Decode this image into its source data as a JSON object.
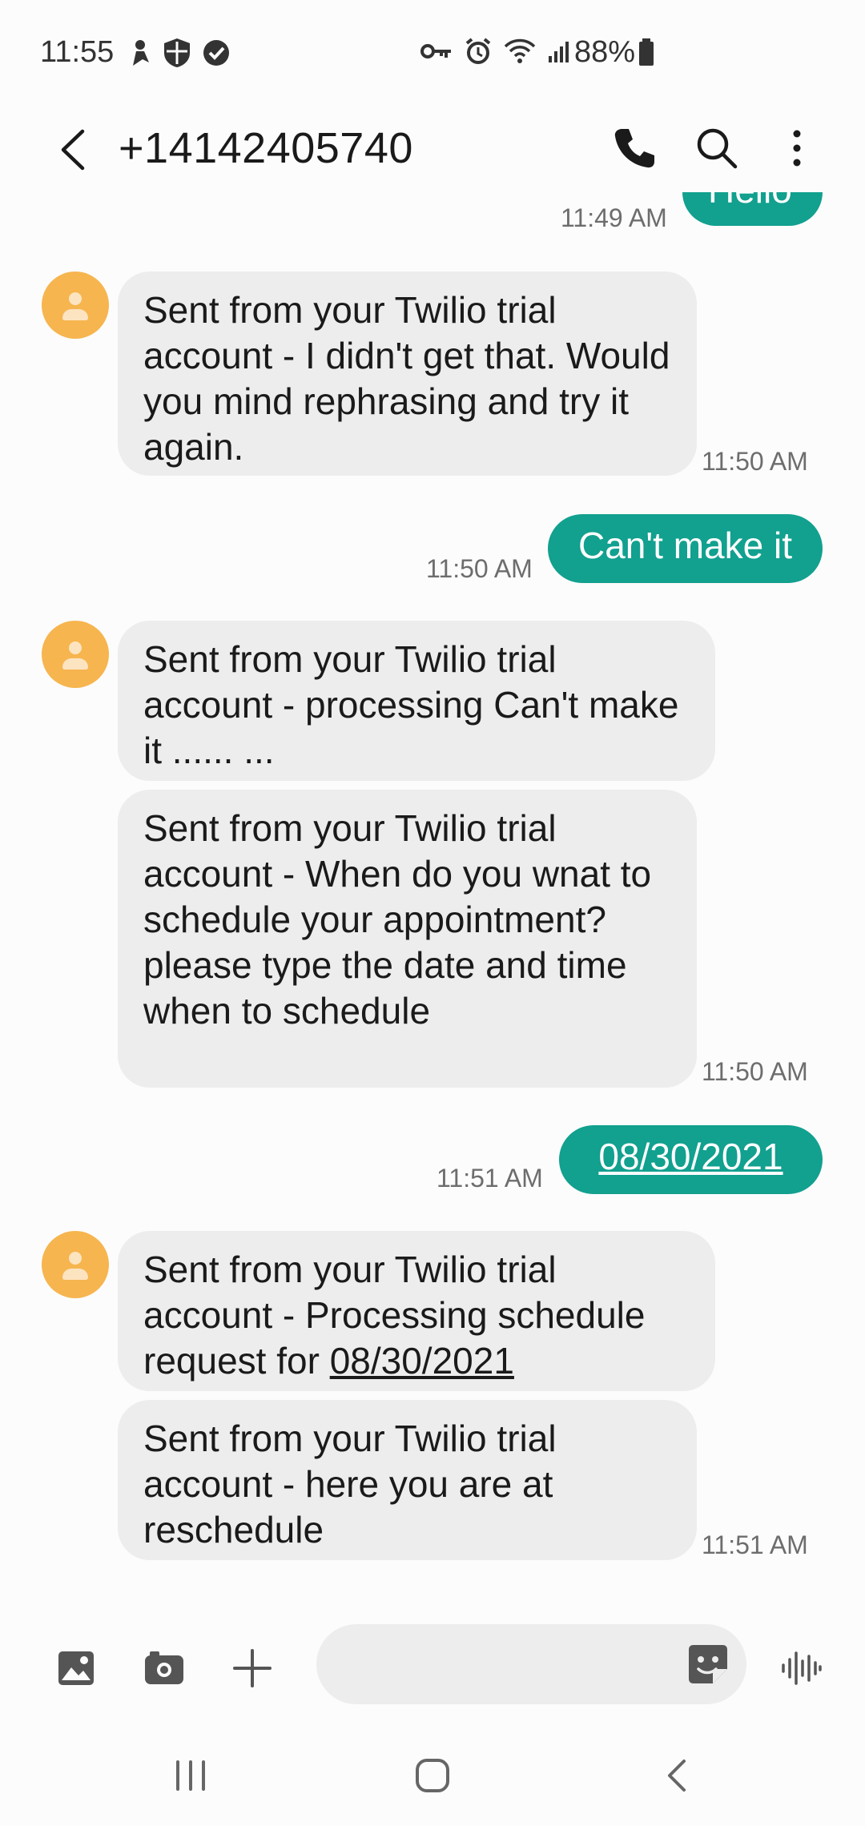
{
  "status_bar": {
    "time": "11:55",
    "battery": "88%"
  },
  "header": {
    "title": "+14142405740"
  },
  "messages": [
    {
      "direction": "out",
      "text": "Hello",
      "time": "11:49 AM"
    },
    {
      "direction": "in",
      "text": "Sent from your Twilio trial account - I didn't get that. Would you mind rephrasing and try it again.",
      "time": "11:50 AM"
    },
    {
      "direction": "out",
      "text": "Can't make it",
      "time": "11:50 AM"
    },
    {
      "direction": "in",
      "text": "Sent from your Twilio trial account - processing Can't make it ...... ...",
      "time": ""
    },
    {
      "direction": "in",
      "text": "Sent from your Twilio trial account - When do you wnat to schedule your appointment? please type the date and time when to schedule",
      "time": "11:50 AM"
    },
    {
      "direction": "out",
      "text": "08/30/2021",
      "time": "11:51 AM"
    },
    {
      "direction": "in",
      "text_prefix": "Sent from your Twilio trial account - Processing schedule request for ",
      "text_link": "08/30/2021",
      "time": ""
    },
    {
      "direction": "in",
      "text": "Sent from your Twilio trial account - here you are at reschedule",
      "time": "11:51 AM"
    }
  ],
  "colors": {
    "accent": "#12a08f",
    "incoming_bubble": "#ededed",
    "avatar": "#f6b54f"
  },
  "icons": {
    "back": "arrow-left-icon",
    "call": "phone-icon",
    "search": "search-icon",
    "more": "more-vert-icon",
    "gallery": "image-icon",
    "camera": "camera-icon",
    "add": "plus-icon",
    "sticker": "sticker-icon",
    "voice": "waveform-icon"
  }
}
